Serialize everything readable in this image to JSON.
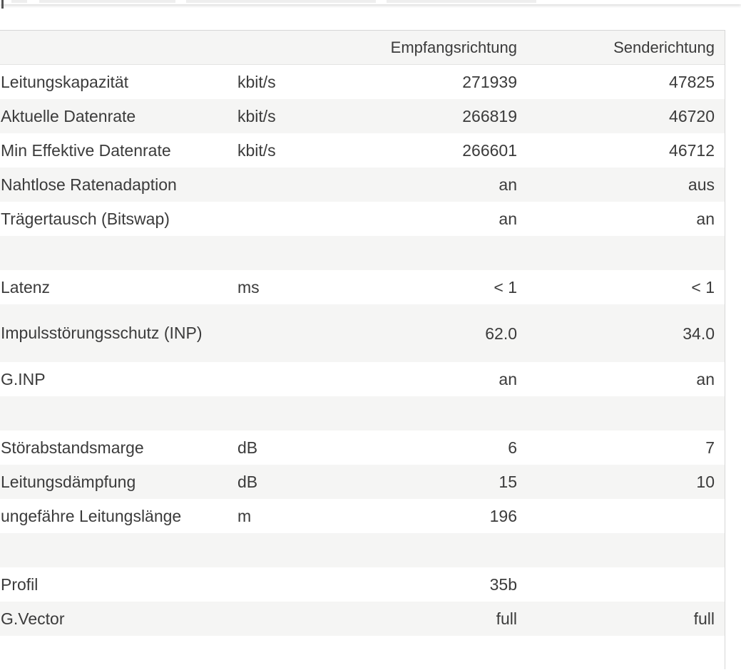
{
  "table": {
    "headers": {
      "label": "",
      "unit": "",
      "rx": "Empfangsrichtung",
      "tx": "Senderichtung"
    },
    "rows": [
      {
        "label": "Leitungskapazität",
        "unit": "kbit/s",
        "rx": "271939",
        "tx": "47825"
      },
      {
        "label": "Aktuelle Datenrate",
        "unit": "kbit/s",
        "rx": "266819",
        "tx": "46720"
      },
      {
        "label": "Min Effektive Datenrate",
        "unit": "kbit/s",
        "rx": "266601",
        "tx": "46712"
      },
      {
        "label": "Nahtlose Ratenadaption",
        "unit": "",
        "rx": "an",
        "tx": "aus"
      },
      {
        "label": "Trägertausch (Bitswap)",
        "unit": "",
        "rx": "an",
        "tx": "an"
      },
      {
        "label": "",
        "unit": "",
        "rx": "",
        "tx": ""
      },
      {
        "label": "Latenz",
        "unit": "ms",
        "rx": "< 1",
        "tx": "< 1"
      },
      {
        "label": "Impulsstörungsschutz (INP)",
        "unit": "",
        "rx": "62.0",
        "tx": "34.0"
      },
      {
        "label": "G.INP",
        "unit": "",
        "rx": "an",
        "tx": "an"
      },
      {
        "label": "",
        "unit": "",
        "rx": "",
        "tx": ""
      },
      {
        "label": "Störabstandsmarge",
        "unit": "dB",
        "rx": "6",
        "tx": "7"
      },
      {
        "label": "Leitungsdämpfung",
        "unit": "dB",
        "rx": "15",
        "tx": "10"
      },
      {
        "label": "ungefähre Leitungslänge",
        "unit": "m",
        "rx": "196",
        "tx": ""
      },
      {
        "label": "",
        "unit": "",
        "rx": "",
        "tx": ""
      },
      {
        "label": "Profil",
        "unit": "",
        "rx": "35b",
        "tx": ""
      },
      {
        "label": "G.Vector",
        "unit": "",
        "rx": "full",
        "tx": "full"
      },
      {
        "label": "",
        "unit": "",
        "rx": "",
        "tx": ""
      }
    ]
  }
}
